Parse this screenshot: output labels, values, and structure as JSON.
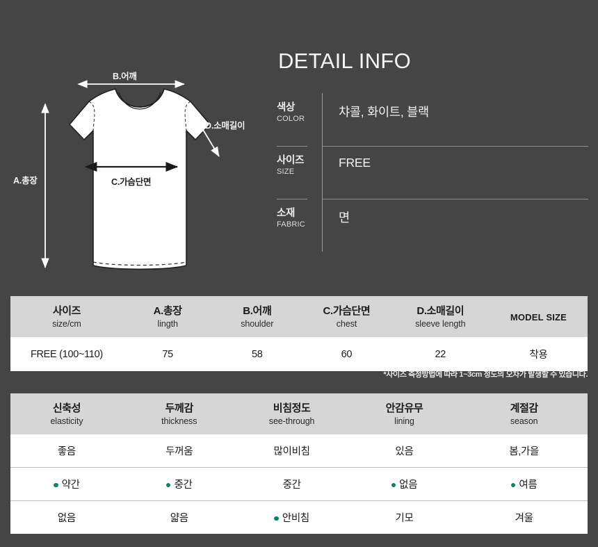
{
  "background_color": "#454545",
  "accent_dot_color": "#12806f",
  "diagram": {
    "labels": {
      "shoulder": "B.어깨",
      "sleeve": "D.소매길이",
      "length": "A.총장",
      "chest": "C.가슴단면"
    },
    "icon_names": {
      "shirt": "tshirt-outline-icon",
      "arrow_shoulder": "double-arrow-horizontal-icon",
      "arrow_sleeve": "double-arrow-diagonal-icon",
      "arrow_length": "double-arrow-vertical-icon",
      "arrow_chest": "double-arrow-horizontal-icon"
    }
  },
  "detail_info": {
    "title": "DETAIL INFO",
    "rows": [
      {
        "key_ko": "색상",
        "key_en": "COLOR",
        "value": "챠콜, 화이트, 블랙"
      },
      {
        "key_ko": "사이즈",
        "key_en": "SIZE",
        "value": "FREE"
      },
      {
        "key_ko": "소재",
        "key_en": "FABRIC",
        "value": "면"
      }
    ]
  },
  "size_table": {
    "headers": [
      {
        "ko": "사이즈",
        "en": "size/cm"
      },
      {
        "ko": "A.총장",
        "en": "lingth"
      },
      {
        "ko": "B.어깨",
        "en": "shoulder"
      },
      {
        "ko": "C.가슴단면",
        "en": "chest"
      },
      {
        "ko": "D.소매길이",
        "en": "sleeve length"
      },
      {
        "solo": "MODEL SIZE"
      }
    ],
    "rows": [
      [
        "FREE (100~110)",
        "75",
        "58",
        "60",
        "22",
        "착용"
      ]
    ]
  },
  "size_note": "*사이즈 측정방법에 따라 1~3cm 정도의 오차가 발생할 수 있습니다.",
  "feature_table": {
    "headers": [
      {
        "ko": "신축성",
        "en": "elasticity"
      },
      {
        "ko": "두께감",
        "en": "thickness"
      },
      {
        "ko": "비침정도",
        "en": "see-through"
      },
      {
        "ko": "안감유무",
        "en": "lining"
      },
      {
        "ko": "계절감",
        "en": "season"
      }
    ],
    "rows": [
      [
        {
          "text": "좋음",
          "selected": false
        },
        {
          "text": "두꺼움",
          "selected": false
        },
        {
          "text": "많이비침",
          "selected": false
        },
        {
          "text": "있음",
          "selected": false
        },
        {
          "text": "봄,가을",
          "selected": false
        }
      ],
      [
        {
          "text": "약간",
          "selected": true
        },
        {
          "text": "중간",
          "selected": true
        },
        {
          "text": "중간",
          "selected": false
        },
        {
          "text": "없음",
          "selected": true
        },
        {
          "text": "여름",
          "selected": true
        }
      ],
      [
        {
          "text": "없음",
          "selected": false
        },
        {
          "text": "얇음",
          "selected": false
        },
        {
          "text": "안비침",
          "selected": true
        },
        {
          "text": "기모",
          "selected": false
        },
        {
          "text": "겨울",
          "selected": false
        }
      ]
    ]
  }
}
